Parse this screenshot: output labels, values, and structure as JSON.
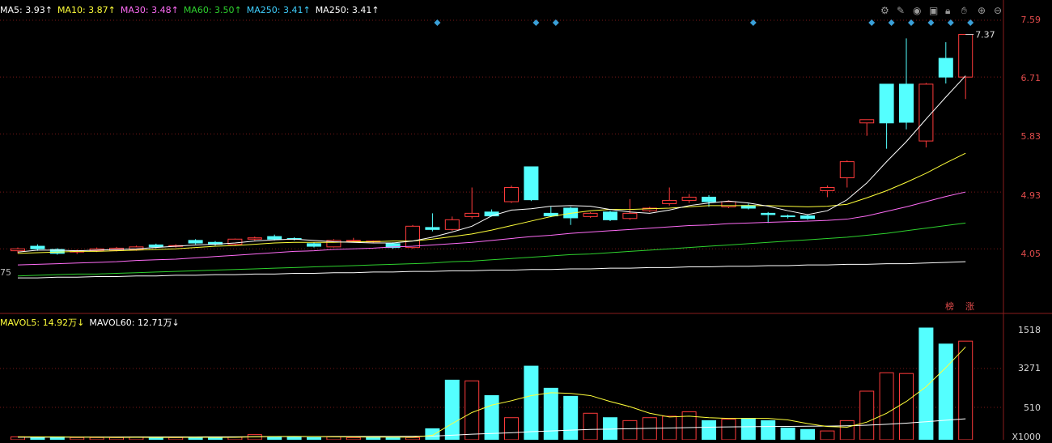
{
  "colors": {
    "up": "#ff3b3b",
    "down": "#54ffff",
    "ma5": "#ffffff",
    "ma10": "#ffff3a",
    "ma30": "#ff6cf6",
    "ma60": "#2ed12e",
    "ma250": "#ffffff",
    "grid": "#7a1818",
    "volma5": "#ffff3a",
    "volma60": "#ffffff"
  },
  "legend": [
    {
      "label": "MA5: 3.93↑",
      "color": "#ffffff"
    },
    {
      "label": "MA10: 3.87↑",
      "color": "#ffff3a"
    },
    {
      "label": "MA30: 3.48↑",
      "color": "#ff6cf6"
    },
    {
      "label": "MA60: 3.50↑",
      "color": "#2ed12e"
    },
    {
      "label": "MA250: 3.41↑",
      "color": "#3fd0ff"
    },
    {
      "label": "MA250: 3.41↑",
      "color": "#ffffff"
    }
  ],
  "vol_legend": [
    {
      "label": "MAVOL5: 14.92万↓",
      "color": "#ffff3a"
    },
    {
      "label": "MAVOL60: 12.71万↓",
      "color": "#ffffff"
    }
  ],
  "toolbar_icons": [
    "gear-icon",
    "pencil-icon",
    "eye-icon",
    "box-icon",
    "lock-icon",
    "hand-icon",
    "zoom-in-icon",
    "zoom-out-icon"
  ],
  "price_labels": [
    "7.59",
    "6.71",
    "5.83",
    "4.93",
    "4.05"
  ],
  "left_fragment": "75",
  "vol_labels": [
    "1518",
    "3271",
    "510",
    "X1000"
  ],
  "tags": [
    "榜",
    "涨"
  ],
  "chart_data": {
    "type": "candlestick",
    "price_range": [
      3.2,
      7.59
    ],
    "last_price_label": "7.37",
    "candles": [
      [
        4.02,
        4.05,
        3.98,
        4.07
      ],
      [
        4.09,
        4.05,
        4.02,
        4.12
      ],
      [
        4.04,
        3.98,
        3.96,
        4.06
      ],
      [
        4.0,
        4.02,
        3.97,
        4.04
      ],
      [
        4.02,
        4.05,
        4.0,
        4.07
      ],
      [
        4.03,
        4.06,
        4.01,
        4.08
      ],
      [
        4.04,
        4.08,
        4.02,
        4.1
      ],
      [
        4.11,
        4.08,
        4.06,
        4.13
      ],
      [
        4.09,
        4.1,
        4.07,
        4.12
      ],
      [
        4.18,
        4.14,
        4.12,
        4.2
      ],
      [
        4.15,
        4.12,
        4.1,
        4.17
      ],
      [
        4.12,
        4.2,
        4.1,
        4.21
      ],
      [
        4.2,
        4.22,
        4.18,
        4.24
      ],
      [
        4.24,
        4.2,
        4.18,
        4.27
      ],
      [
        4.21,
        4.2,
        4.18,
        4.23
      ],
      [
        4.13,
        4.09,
        4.07,
        4.15
      ],
      [
        4.08,
        4.18,
        4.07,
        4.2
      ],
      [
        4.18,
        4.18,
        4.15,
        4.22
      ],
      [
        4.16,
        4.17,
        4.14,
        4.18
      ],
      [
        4.13,
        4.07,
        4.05,
        4.15
      ],
      [
        4.07,
        4.4,
        4.05,
        4.42
      ],
      [
        4.38,
        4.35,
        4.32,
        4.6
      ],
      [
        4.35,
        4.5,
        4.33,
        4.55
      ],
      [
        4.55,
        4.6,
        4.52,
        5.0
      ],
      [
        4.62,
        4.56,
        4.55,
        4.66
      ],
      [
        4.78,
        5.0,
        4.76,
        5.03
      ],
      [
        5.32,
        4.81,
        4.79,
        5.32
      ],
      [
        4.6,
        4.56,
        4.54,
        4.7
      ],
      [
        4.68,
        4.53,
        4.42,
        4.7
      ],
      [
        4.55,
        4.6,
        4.53,
        4.62
      ],
      [
        4.62,
        4.5,
        4.48,
        4.64
      ],
      [
        4.52,
        4.6,
        4.5,
        4.82
      ],
      [
        4.64,
        4.68,
        4.62,
        4.7
      ],
      [
        4.75,
        4.8,
        4.72,
        5.0
      ],
      [
        4.8,
        4.85,
        4.76,
        4.9
      ],
      [
        4.85,
        4.78,
        4.7,
        4.88
      ],
      [
        4.7,
        4.78,
        4.68,
        4.8
      ],
      [
        4.72,
        4.68,
        4.66,
        4.75
      ],
      [
        4.6,
        4.58,
        4.45,
        4.62
      ],
      [
        4.56,
        4.55,
        4.52,
        4.58
      ],
      [
        4.56,
        4.52,
        4.5,
        4.58
      ],
      [
        4.95,
        5.0,
        4.85,
        5.03
      ],
      [
        5.15,
        5.4,
        5.0,
        5.42
      ],
      [
        6.0,
        6.05,
        5.8,
        6.05
      ],
      [
        6.6,
        6.0,
        5.6,
        6.6
      ],
      [
        6.6,
        6.01,
        5.9,
        7.31
      ],
      [
        5.72,
        6.6,
        5.62,
        6.62
      ],
      [
        7.0,
        6.71,
        6.61,
        7.25
      ],
      [
        6.71,
        7.37,
        6.37,
        7.37
      ]
    ],
    "ma5": [
      4.0,
      4.03,
      4.03,
      4.02,
      4.03,
      4.04,
      4.05,
      4.07,
      4.09,
      4.11,
      4.12,
      4.14,
      4.17,
      4.19,
      4.2,
      4.18,
      4.16,
      4.15,
      4.14,
      4.14,
      4.17,
      4.23,
      4.31,
      4.4,
      4.56,
      4.65,
      4.67,
      4.71,
      4.72,
      4.71,
      4.66,
      4.62,
      4.6,
      4.65,
      4.72,
      4.76,
      4.79,
      4.76,
      4.71,
      4.64,
      4.58,
      4.64,
      4.81,
      5.07,
      5.4,
      5.71,
      6.06,
      6.4,
      6.73
    ],
    "ma10": [
      3.98,
      3.99,
      4.0,
      4.01,
      4.01,
      4.02,
      4.03,
      4.04,
      4.05,
      4.07,
      4.09,
      4.1,
      4.12,
      4.14,
      4.15,
      4.15,
      4.15,
      4.16,
      4.16,
      4.17,
      4.17,
      4.2,
      4.24,
      4.28,
      4.34,
      4.41,
      4.48,
      4.55,
      4.6,
      4.64,
      4.66,
      4.66,
      4.67,
      4.68,
      4.7,
      4.72,
      4.72,
      4.72,
      4.72,
      4.71,
      4.7,
      4.71,
      4.74,
      4.84,
      4.95,
      5.08,
      5.22,
      5.38,
      5.53
    ],
    "ma30": [
      3.8,
      3.81,
      3.82,
      3.83,
      3.84,
      3.85,
      3.87,
      3.88,
      3.89,
      3.91,
      3.93,
      3.95,
      3.97,
      3.99,
      4.01,
      4.02,
      4.04,
      4.05,
      4.06,
      4.08,
      4.09,
      4.11,
      4.13,
      4.15,
      4.18,
      4.21,
      4.24,
      4.26,
      4.29,
      4.31,
      4.33,
      4.35,
      4.37,
      4.39,
      4.41,
      4.42,
      4.44,
      4.45,
      4.46,
      4.47,
      4.48,
      4.49,
      4.51,
      4.56,
      4.63,
      4.7,
      4.78,
      4.86,
      4.93
    ],
    "ma60": [
      3.63,
      3.64,
      3.65,
      3.66,
      3.66,
      3.67,
      3.68,
      3.69,
      3.7,
      3.71,
      3.72,
      3.73,
      3.74,
      3.75,
      3.76,
      3.77,
      3.78,
      3.79,
      3.8,
      3.81,
      3.82,
      3.83,
      3.85,
      3.86,
      3.88,
      3.9,
      3.92,
      3.94,
      3.96,
      3.97,
      3.99,
      4.01,
      4.03,
      4.05,
      4.07,
      4.09,
      4.11,
      4.13,
      4.15,
      4.17,
      4.19,
      4.21,
      4.23,
      4.26,
      4.29,
      4.33,
      4.37,
      4.41,
      4.45
    ],
    "ma250": [
      3.6,
      3.6,
      3.61,
      3.61,
      3.62,
      3.62,
      3.63,
      3.63,
      3.64,
      3.64,
      3.65,
      3.65,
      3.66,
      3.66,
      3.67,
      3.67,
      3.68,
      3.68,
      3.69,
      3.69,
      3.7,
      3.7,
      3.71,
      3.71,
      3.72,
      3.72,
      3.73,
      3.73,
      3.74,
      3.74,
      3.75,
      3.75,
      3.76,
      3.76,
      3.77,
      3.77,
      3.78,
      3.78,
      3.79,
      3.79,
      3.8,
      3.8,
      3.81,
      3.81,
      3.82,
      3.82,
      3.83,
      3.84,
      3.85
    ],
    "volume_range": [
      0,
      1518
    ],
    "volumes": [
      40,
      30,
      40,
      30,
      30,
      30,
      35,
      30,
      30,
      35,
      30,
      35,
      70,
      40,
      40,
      30,
      40,
      30,
      40,
      30,
      30,
      150,
      810,
      800,
      600,
      300,
      1000,
      700,
      590,
      360,
      300,
      260,
      300,
      320,
      380,
      260,
      280,
      290,
      260,
      160,
      140,
      120,
      260,
      660,
      910,
      900,
      1518,
      1300,
      1340
    ],
    "volume_up": [
      true,
      false,
      false,
      true,
      true,
      true,
      true,
      false,
      true,
      false,
      false,
      true,
      true,
      false,
      false,
      false,
      true,
      true,
      false,
      false,
      true,
      false,
      false,
      true,
      false,
      true,
      false,
      false,
      false,
      true,
      false,
      true,
      true,
      true,
      true,
      false,
      true,
      false,
      false,
      false,
      false,
      true,
      true,
      true,
      true,
      true,
      false,
      false,
      true
    ],
    "volma5": [
      40,
      40,
      38,
      36,
      34,
      32,
      33,
      32,
      32,
      33,
      32,
      33,
      40,
      44,
      46,
      44,
      40,
      38,
      36,
      36,
      34,
      60,
      220,
      370,
      470,
      530,
      600,
      640,
      630,
      600,
      520,
      450,
      360,
      310,
      320,
      300,
      290,
      290,
      290,
      270,
      220,
      180,
      170,
      240,
      360,
      520,
      720,
      980,
      1260
    ],
    "volma60": [
      35,
      35,
      36,
      36,
      37,
      37,
      38,
      38,
      39,
      39,
      40,
      40,
      41,
      42,
      42,
      43,
      44,
      44,
      45,
      46,
      47,
      50,
      62,
      75,
      85,
      95,
      110,
      120,
      130,
      140,
      145,
      150,
      155,
      160,
      165,
      170,
      175,
      178,
      180,
      182,
      184,
      186,
      190,
      198,
      210,
      225,
      245,
      265,
      285
    ]
  }
}
